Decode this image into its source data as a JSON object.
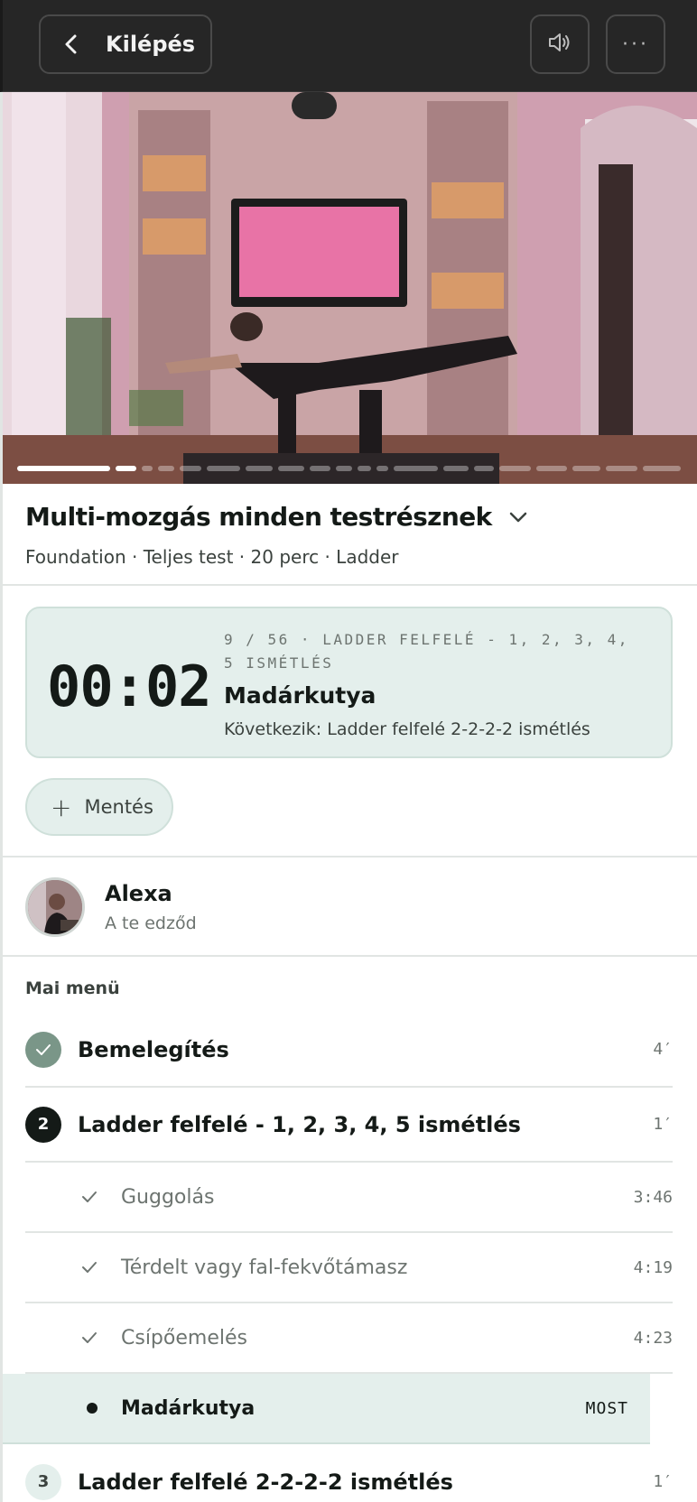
{
  "header": {
    "back_label": "Kilépés",
    "icons": [
      "chevron-left-icon",
      "speaker-icon",
      "more-dots-icon"
    ],
    "more_glyph": "···"
  },
  "video": {
    "progress_segments_total": 20,
    "progress_segments_done": 2
  },
  "workout": {
    "title": "Multi-mozgás minden testrésznek",
    "subtitle": "Foundation · Teljes test · 20 perc · Ladder"
  },
  "timer": {
    "time": "00:02",
    "meta": "9 / 56 · LADDER FELFELÉ - 1, 2, 3, 4, 5 ISMÉTLÉS",
    "exercise": "Madárkutya",
    "next": "Következik: Ladder felfelé 2-2-2-2 ismétlés"
  },
  "save": {
    "label": "Mentés"
  },
  "trainer": {
    "name": "Alexa",
    "role": "A te edződ"
  },
  "menu": {
    "heading": "Mai menü",
    "sections": [
      {
        "badge": "",
        "label": "Bemelegítés",
        "duration": "4′",
        "state": "done"
      },
      {
        "badge": "2",
        "label": "Ladder felfelé - 1, 2, 3, 4, 5 ismétlés",
        "duration": "1′",
        "state": "current"
      },
      {
        "badge": "3",
        "label": "Ladder felfelé 2-2-2-2 ismétlés",
        "duration": "1′",
        "state": "upcoming"
      }
    ],
    "subitems": [
      {
        "label": "Guggolás",
        "time": "3:46"
      },
      {
        "label": "Térdelt vagy fal-fekvőtámasz",
        "time": "4:19"
      },
      {
        "label": "Csípőemelés",
        "time": "4:23"
      }
    ],
    "current_item": {
      "label": "Madárkutya",
      "tag": "MOST"
    }
  },
  "colors": {
    "accent_bg": "#e4efec",
    "topbar": "#262626",
    "done_badge": "#7a9688",
    "text": "#141a17"
  }
}
